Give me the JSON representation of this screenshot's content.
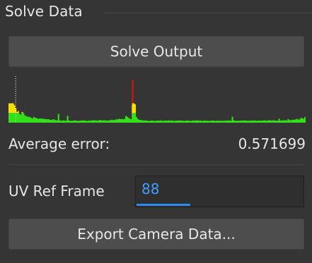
{
  "section": {
    "title": "Solve Data"
  },
  "solve_button": {
    "label": "Solve Output"
  },
  "chart_data": {
    "type": "bar",
    "title": "",
    "thresholds": {
      "green_max": 0.5,
      "yellow_max": 1.0
    },
    "colors": {
      "green": "#33e01a",
      "yellow": "#f5e000",
      "red": "#e01010"
    },
    "values": [
      1.35,
      1.2,
      1.0,
      1.05,
      0.9,
      0.75,
      0.55,
      0.6,
      0.45,
      0.42,
      0.55,
      0.5,
      0.38,
      0.35,
      0.3,
      0.32,
      0.28,
      0.25,
      0.22,
      0.3,
      0.25,
      0.24,
      0.2,
      0.21,
      0.22,
      0.2,
      0.22,
      0.18,
      0.19,
      0.17,
      0.18,
      0.16,
      0.15,
      0.14,
      0.18,
      0.15,
      0.12,
      0.13,
      0.45,
      0.12,
      0.1,
      0.11,
      0.12,
      0.1,
      0.1,
      0.35,
      0.11,
      0.1,
      0.09,
      0.1,
      0.11,
      0.12,
      0.1,
      0.09,
      0.1,
      0.11,
      0.1,
      0.12,
      0.11,
      0.1,
      0.09,
      0.1,
      0.11,
      0.1,
      0.12,
      0.13,
      0.12,
      0.11,
      0.1,
      0.12,
      0.14,
      0.12,
      0.11,
      0.13,
      0.12,
      0.1,
      0.11,
      0.12,
      0.13,
      0.15,
      0.14,
      0.13,
      0.16,
      0.17,
      0.18,
      0.2,
      0.18,
      0.19,
      0.17,
      0.2,
      0.35,
      0.3,
      0.25,
      0.2,
      0.18,
      0.9,
      1.0,
      0.95,
      0.3,
      0.2,
      0.15,
      0.14,
      0.13,
      0.12,
      0.11,
      0.12,
      0.1,
      0.1,
      0.09,
      0.1,
      0.11,
      0.1,
      0.09,
      0.1,
      0.1,
      0.11,
      0.1,
      0.12,
      0.09,
      0.1,
      0.1,
      0.11,
      0.1,
      0.12,
      0.1,
      0.11,
      0.1,
      0.09,
      0.1,
      0.11,
      0.1,
      0.12,
      0.11,
      0.1,
      0.1,
      0.09,
      0.1,
      0.11,
      0.1,
      0.1,
      0.09,
      0.1,
      0.12,
      0.1,
      0.11,
      0.12,
      0.1,
      0.11,
      0.1,
      0.09,
      0.11,
      0.1,
      0.1,
      0.1,
      0.09,
      0.1,
      0.1,
      0.11,
      0.1,
      0.09,
      0.1,
      0.1,
      0.1,
      0.1,
      0.09,
      0.1,
      0.1,
      0.11,
      0.1,
      0.12,
      0.1,
      0.1,
      0.3,
      0.12,
      0.1,
      0.09,
      0.1,
      0.1,
      0.1,
      0.11,
      0.1,
      0.12,
      0.11,
      0.1,
      0.1,
      0.1,
      0.1,
      0.11,
      0.1,
      0.12,
      0.1,
      0.1,
      0.1,
      0.11,
      0.1,
      0.1,
      0.12,
      0.12,
      0.1,
      0.11,
      0.12,
      0.13,
      0.1,
      0.12,
      0.12,
      0.11,
      0.1,
      0.1,
      0.2,
      0.1,
      0.12,
      0.11,
      0.12,
      0.13,
      0.1,
      0.18,
      0.14,
      0.12,
      0.15,
      0.14,
      0.16,
      0.17,
      0.2,
      0.15,
      0.18,
      0.25,
      0.22,
      0.2,
      0.3
    ],
    "highlight_index": 95,
    "highlight_value": 2.2,
    "marker_index": 5
  },
  "average_error": {
    "label": "Average error:",
    "value": "0.571699"
  },
  "uv_ref_frame": {
    "label": "UV Ref Frame",
    "value": "88"
  },
  "export_button": {
    "label": "Export Camera Data..."
  }
}
